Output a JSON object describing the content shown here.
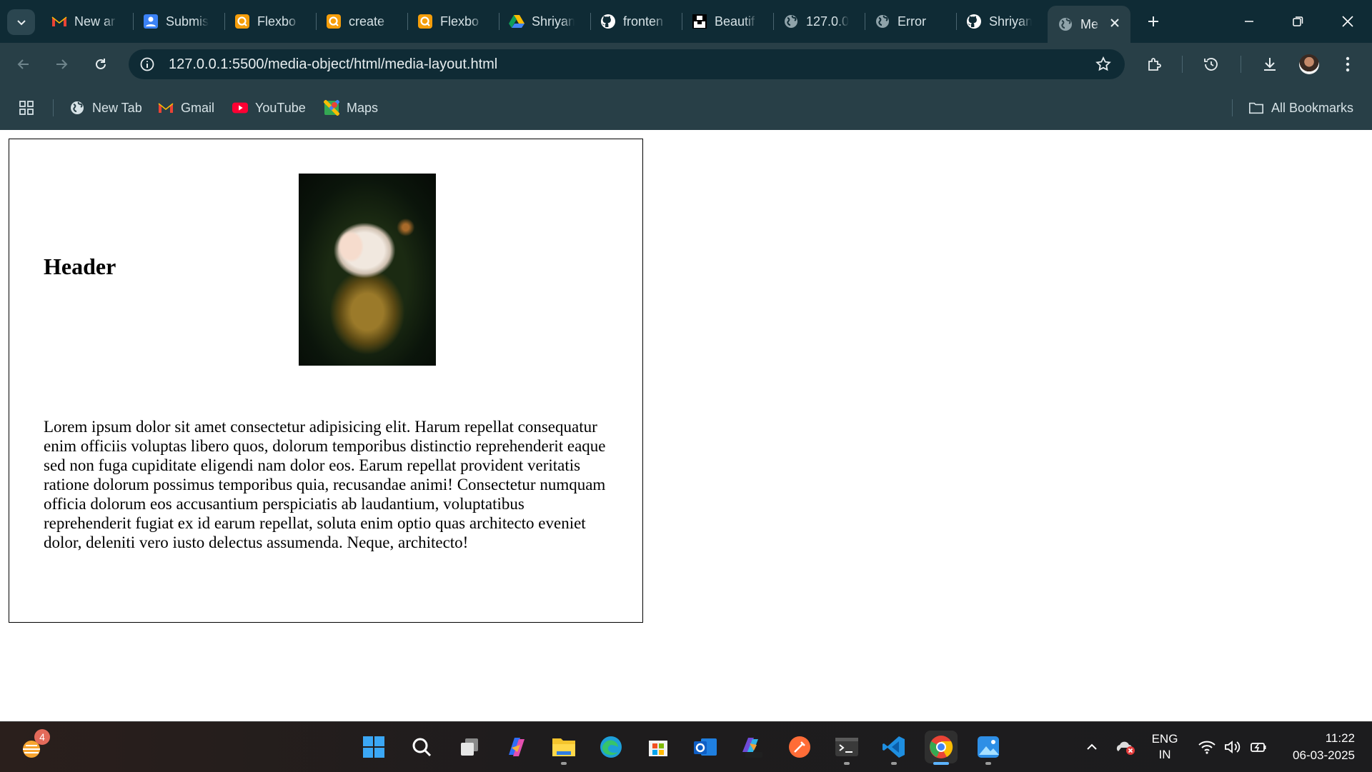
{
  "browser": {
    "tabs": [
      {
        "title": "New ar",
        "icon": "gmail-icon"
      },
      {
        "title": "Submis",
        "icon": "contact-form-icon"
      },
      {
        "title": "Flexbo",
        "icon": "quiz-icon"
      },
      {
        "title": "create",
        "icon": "quiz-icon"
      },
      {
        "title": "Flexbo",
        "icon": "quiz-icon"
      },
      {
        "title": "Shriyan",
        "icon": "google-drive-icon"
      },
      {
        "title": "fronten",
        "icon": "github-icon"
      },
      {
        "title": "Beautif",
        "icon": "unsplash-icon"
      },
      {
        "title": "127.0.0",
        "icon": "globe-icon"
      },
      {
        "title": "Error",
        "icon": "globe-icon"
      },
      {
        "title": "Shriyan",
        "icon": "github-icon"
      }
    ],
    "active_tab": {
      "title": "Me",
      "icon": "globe-icon"
    },
    "url": "127.0.0.1:5500/media-object/html/media-layout.html",
    "bookmarks": [
      {
        "label": "New Tab",
        "icon": "globe-icon"
      },
      {
        "label": "Gmail",
        "icon": "gmail-icon"
      },
      {
        "label": "YouTube",
        "icon": "youtube-icon"
      },
      {
        "label": "Maps",
        "icon": "maps-icon"
      }
    ],
    "all_bookmarks_label": "All Bookmarks"
  },
  "page": {
    "header": "Header",
    "image_icon": "photo-woman-blonde",
    "paragraph": "Lorem ipsum dolor sit amet consectetur adipisicing elit. Harum repellat consequatur enim officiis voluptas libero quos, dolorum temporibus distinctio reprehenderit eaque sed non fuga cupiditate eligendi nam dolor eos. Earum repellat provident veritatis ratione dolorum possimus temporibus quia, recusandae animi! Consectetur numquam officia dolorum eos accusantium perspiciatis ab laudantium, voluptatibus reprehenderit fugiat ex id earum repellat, soluta enim optio quas architecto eveniet dolor, deleniti vero iusto delectus assumenda. Neque, architecto!"
  },
  "taskbar": {
    "weather_badge": "4",
    "apps": [
      "start-icon",
      "search-icon",
      "task-view-icon",
      "copilot-icon",
      "file-explorer-icon",
      "edge-icon",
      "store-icon",
      "outlook-icon",
      "m365-icon",
      "postman-icon",
      "terminal-icon",
      "vscode-icon",
      "chrome-icon",
      "photos-icon"
    ],
    "lang_line1": "ENG",
    "lang_line2": "IN",
    "time": "11:22",
    "date": "06-03-2025"
  },
  "colors": {
    "tabstrip_bg": "#0f2b35",
    "toolbar_bg": "#283f47",
    "accent": "#5cb3ff"
  }
}
